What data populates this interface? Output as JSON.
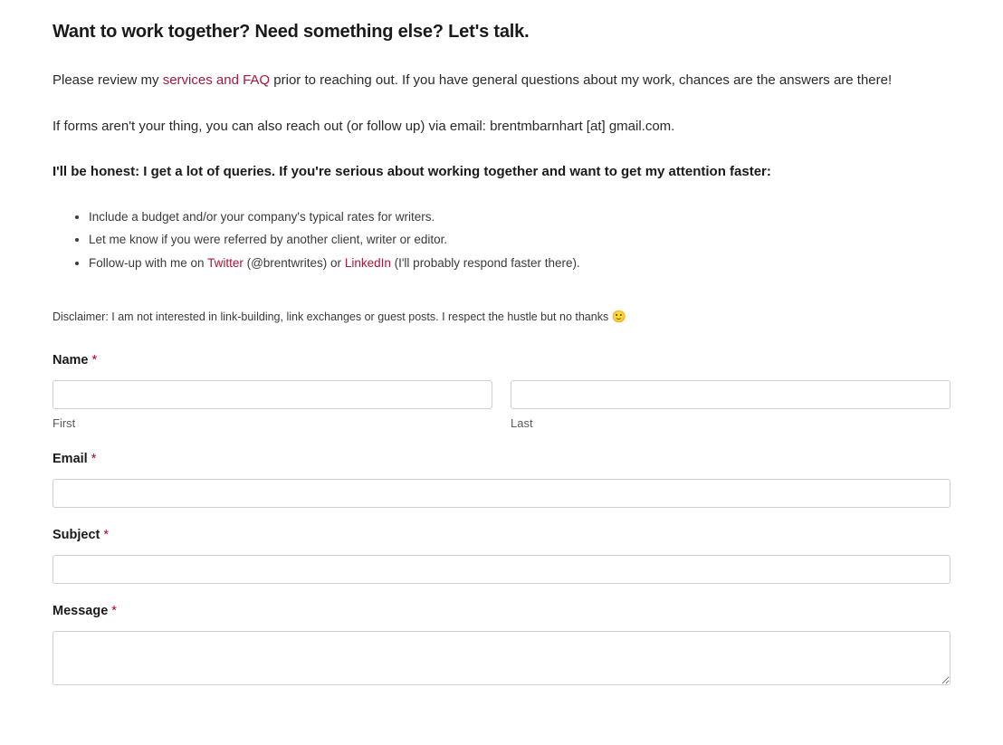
{
  "heading": "Want to work together? Need something else? Let's talk.",
  "intro_before_link": "Please review my ",
  "services_link": "services and FAQ",
  "intro_after_link": " prior to reaching out. If you have general questions about my work, chances are the answers are there!",
  "alt_contact": "If forms aren't your thing, you can also reach out (or follow up) via email: brentmbarnhart [at] gmail.com.",
  "honest": "I'll be honest: I get a lot of queries. If you're serious about working together and want to get my attention faster:",
  "bullets": {
    "b0": "Include a budget and/or your company's typical rates for writers.",
    "b1": "Let me know if you were referred by another client, writer or editor.",
    "b2_pre": "Follow-up with me on ",
    "b2_twitter": "Twitter",
    "b2_mid": " (@brentwrites) or ",
    "b2_linkedin": "LinkedIn",
    "b2_post": " (I'll probably respond faster there)."
  },
  "disclaimer_text": "Disclaimer: I am not interested in link-building, link exchanges or guest posts. I respect the hustle but no thanks ",
  "disclaimer_emoji": "🙂",
  "form": {
    "name_label": "Name ",
    "first_sub": "First",
    "last_sub": "Last",
    "email_label": "Email ",
    "subject_label": "Subject ",
    "message_label": "Message ",
    "required": "*"
  }
}
